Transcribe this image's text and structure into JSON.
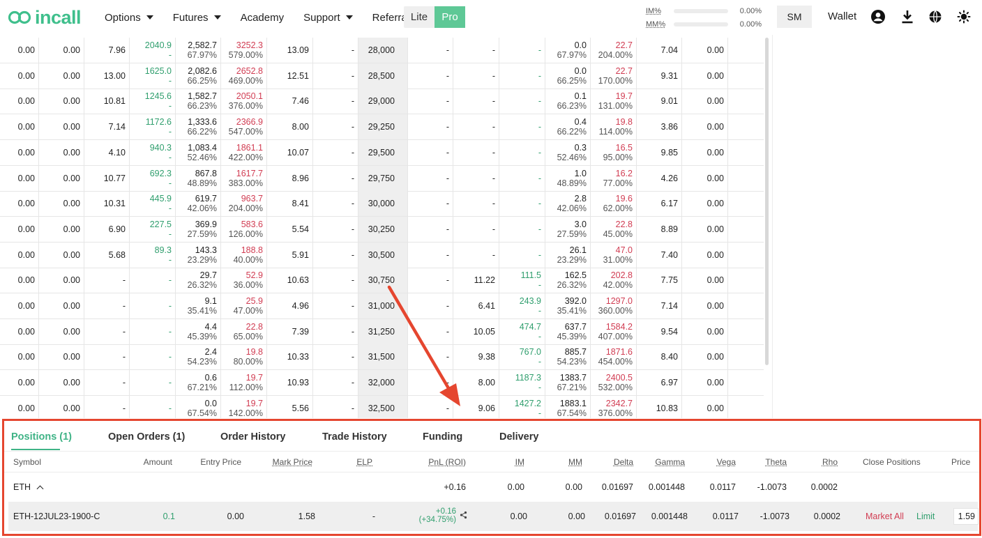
{
  "header": {
    "logo_text": "incall",
    "nav": [
      {
        "label": "Options",
        "has_dropdown": true
      },
      {
        "label": "Futures",
        "has_dropdown": true
      },
      {
        "label": "Academy",
        "has_dropdown": false
      },
      {
        "label": "Support",
        "has_dropdown": true
      },
      {
        "label": "Referral",
        "has_dropdown": false
      }
    ],
    "mode": {
      "lite": "Lite",
      "pro": "Pro",
      "active": "Pro"
    },
    "margin": {
      "im_label": "IM%",
      "im_value": "0.00%",
      "mm_label": "MM%",
      "mm_value": "0.00%"
    },
    "user_button": "SM",
    "wallet": "Wallet",
    "icons": [
      "account-icon",
      "download-icon",
      "globe-icon",
      "theme-sun-icon"
    ]
  },
  "chain": {
    "rows": [
      {
        "c": [
          "0.00",
          "0.00",
          "7.96"
        ],
        "bid": [
          "2040.9",
          "-"
        ],
        "mark": [
          "2,582.7",
          "67.97%"
        ],
        "ask": [
          "3252.3",
          "579.00%"
        ],
        "v": [
          "13.09",
          "-"
        ],
        "strike": "28,000",
        "p": [
          "-",
          "-"
        ],
        "pbid": [
          "-",
          ""
        ],
        "pmark": [
          "0.0",
          "67.97%"
        ],
        "pask": [
          "22.7",
          "204.00%"
        ],
        "e": [
          "7.04",
          "0.00"
        ]
      },
      {
        "c": [
          "0.00",
          "0.00",
          "13.00"
        ],
        "bid": [
          "1625.0",
          "-"
        ],
        "mark": [
          "2,082.6",
          "66.25%"
        ],
        "ask": [
          "2652.8",
          "469.00%"
        ],
        "v": [
          "12.51",
          "-"
        ],
        "strike": "28,500",
        "p": [
          "-",
          "-"
        ],
        "pbid": [
          "-",
          ""
        ],
        "pmark": [
          "0.0",
          "66.25%"
        ],
        "pask": [
          "22.7",
          "170.00%"
        ],
        "e": [
          "9.31",
          "0.00"
        ]
      },
      {
        "c": [
          "0.00",
          "0.00",
          "10.81"
        ],
        "bid": [
          "1245.6",
          "-"
        ],
        "mark": [
          "1,582.7",
          "66.23%"
        ],
        "ask": [
          "2050.1",
          "376.00%"
        ],
        "v": [
          "7.46",
          "-"
        ],
        "strike": "29,000",
        "p": [
          "-",
          "-"
        ],
        "pbid": [
          "-",
          ""
        ],
        "pmark": [
          "0.1",
          "66.23%"
        ],
        "pask": [
          "19.7",
          "131.00%"
        ],
        "e": [
          "9.01",
          "0.00"
        ]
      },
      {
        "c": [
          "0.00",
          "0.00",
          "7.14"
        ],
        "bid": [
          "1172.6",
          "-"
        ],
        "mark": [
          "1,333.6",
          "66.22%"
        ],
        "ask": [
          "2366.9",
          "547.00%"
        ],
        "v": [
          "8.00",
          "-"
        ],
        "strike": "29,250",
        "p": [
          "-",
          "-"
        ],
        "pbid": [
          "-",
          ""
        ],
        "pmark": [
          "0.4",
          "66.22%"
        ],
        "pask": [
          "19.8",
          "114.00%"
        ],
        "e": [
          "3.86",
          "0.00"
        ]
      },
      {
        "c": [
          "0.00",
          "0.00",
          "4.10"
        ],
        "bid": [
          "940.3",
          "-"
        ],
        "mark": [
          "1,083.4",
          "52.46%"
        ],
        "ask": [
          "1861.1",
          "422.00%"
        ],
        "v": [
          "10.07",
          "-"
        ],
        "strike": "29,500",
        "p": [
          "-",
          "-"
        ],
        "pbid": [
          "-",
          ""
        ],
        "pmark": [
          "0.3",
          "52.46%"
        ],
        "pask": [
          "16.5",
          "95.00%"
        ],
        "e": [
          "9.85",
          "0.00"
        ]
      },
      {
        "c": [
          "0.00",
          "0.00",
          "10.77"
        ],
        "bid": [
          "692.3",
          "-"
        ],
        "mark": [
          "867.8",
          "48.89%"
        ],
        "ask": [
          "1617.7",
          "383.00%"
        ],
        "v": [
          "8.96",
          "-"
        ],
        "strike": "29,750",
        "p": [
          "-",
          "-"
        ],
        "pbid": [
          "-",
          ""
        ],
        "pmark": [
          "1.0",
          "48.89%"
        ],
        "pask": [
          "16.2",
          "77.00%"
        ],
        "e": [
          "4.26",
          "0.00"
        ]
      },
      {
        "c": [
          "0.00",
          "0.00",
          "10.31"
        ],
        "bid": [
          "445.9",
          "-"
        ],
        "mark": [
          "619.7",
          "42.06%"
        ],
        "ask": [
          "963.7",
          "204.00%"
        ],
        "v": [
          "8.41",
          "-"
        ],
        "strike": "30,000",
        "p": [
          "-",
          "-"
        ],
        "pbid": [
          "-",
          ""
        ],
        "pmark": [
          "2.8",
          "42.06%"
        ],
        "pask": [
          "19.6",
          "62.00%"
        ],
        "e": [
          "6.17",
          "0.00"
        ]
      },
      {
        "c": [
          "0.00",
          "0.00",
          "6.90"
        ],
        "bid": [
          "227.5",
          "-"
        ],
        "mark": [
          "369.9",
          "27.59%"
        ],
        "ask": [
          "583.6",
          "126.00%"
        ],
        "v": [
          "5.54",
          "-"
        ],
        "strike": "30,250",
        "p": [
          "-",
          "-"
        ],
        "pbid": [
          "-",
          ""
        ],
        "pmark": [
          "3.0",
          "27.59%"
        ],
        "pask": [
          "22.8",
          "45.00%"
        ],
        "e": [
          "8.89",
          "0.00"
        ]
      },
      {
        "c": [
          "0.00",
          "0.00",
          "5.68"
        ],
        "bid": [
          "89.3",
          "-"
        ],
        "mark": [
          "143.3",
          "23.29%"
        ],
        "ask": [
          "188.8",
          "40.00%"
        ],
        "v": [
          "5.91",
          "-"
        ],
        "strike": "30,500",
        "p": [
          "-",
          "-"
        ],
        "pbid": [
          "-",
          ""
        ],
        "pmark": [
          "26.1",
          "23.29%"
        ],
        "pask": [
          "47.0",
          "31.00%"
        ],
        "e": [
          "7.40",
          "0.00"
        ]
      },
      {
        "c": [
          "0.00",
          "0.00",
          "-"
        ],
        "bid": [
          "-",
          ""
        ],
        "mark": [
          "29.7",
          "26.32%"
        ],
        "ask": [
          "52.9",
          "36.00%"
        ],
        "v": [
          "10.63",
          "-"
        ],
        "strike": "30,750",
        "p": [
          "-",
          "11.22"
        ],
        "pbid": [
          "111.5",
          "-"
        ],
        "pmark": [
          "162.5",
          "26.32%"
        ],
        "pask": [
          "202.8",
          "42.00%"
        ],
        "e": [
          "7.75",
          "0.00"
        ]
      },
      {
        "c": [
          "0.00",
          "0.00",
          "-"
        ],
        "bid": [
          "-",
          ""
        ],
        "mark": [
          "9.1",
          "35.41%"
        ],
        "ask": [
          "25.9",
          "47.00%"
        ],
        "v": [
          "4.96",
          "-"
        ],
        "strike": "31,000",
        "p": [
          "-",
          "6.41"
        ],
        "pbid": [
          "243.9",
          "-"
        ],
        "pmark": [
          "392.0",
          "35.41%"
        ],
        "pask": [
          "1297.0",
          "360.00%"
        ],
        "e": [
          "7.14",
          "0.00"
        ]
      },
      {
        "c": [
          "0.00",
          "0.00",
          "-"
        ],
        "bid": [
          "-",
          ""
        ],
        "mark": [
          "4.4",
          "45.39%"
        ],
        "ask": [
          "22.8",
          "65.00%"
        ],
        "v": [
          "7.39",
          "-"
        ],
        "strike": "31,250",
        "p": [
          "-",
          "10.05"
        ],
        "pbid": [
          "474.7",
          "-"
        ],
        "pmark": [
          "637.7",
          "45.39%"
        ],
        "pask": [
          "1584.2",
          "407.00%"
        ],
        "e": [
          "9.54",
          "0.00"
        ]
      },
      {
        "c": [
          "0.00",
          "0.00",
          "-"
        ],
        "bid": [
          "-",
          ""
        ],
        "mark": [
          "2.4",
          "54.23%"
        ],
        "ask": [
          "19.8",
          "80.00%"
        ],
        "v": [
          "10.33",
          "-"
        ],
        "strike": "31,500",
        "p": [
          "-",
          "9.38"
        ],
        "pbid": [
          "767.0",
          "-"
        ],
        "pmark": [
          "885.7",
          "54.23%"
        ],
        "pask": [
          "1871.6",
          "454.00%"
        ],
        "e": [
          "8.40",
          "0.00"
        ]
      },
      {
        "c": [
          "0.00",
          "0.00",
          "-"
        ],
        "bid": [
          "-",
          ""
        ],
        "mark": [
          "0.6",
          "67.21%"
        ],
        "ask": [
          "19.7",
          "112.00%"
        ],
        "v": [
          "10.93",
          "-"
        ],
        "strike": "32,000",
        "p": [
          "-",
          "8.00"
        ],
        "pbid": [
          "1187.3",
          "-"
        ],
        "pmark": [
          "1383.7",
          "67.21%"
        ],
        "pask": [
          "2400.5",
          "532.00%"
        ],
        "e": [
          "6.97",
          "0.00"
        ]
      },
      {
        "c": [
          "0.00",
          "0.00",
          "-"
        ],
        "bid": [
          "-",
          ""
        ],
        "mark": [
          "0.0",
          "67.54%"
        ],
        "ask": [
          "19.7",
          "142.00%"
        ],
        "v": [
          "5.56",
          "-"
        ],
        "strike": "32,500",
        "p": [
          "-",
          "9.06"
        ],
        "pbid": [
          "1427.2",
          "-"
        ],
        "pmark": [
          "1883.1",
          "67.54%"
        ],
        "pask": [
          "2342.7",
          "376.00%"
        ],
        "e": [
          "10.83",
          "0.00"
        ]
      }
    ]
  },
  "positions": {
    "tabs": [
      "Positions (1)",
      "Open Orders (1)",
      "Order History",
      "Trade History",
      "Funding",
      "Delivery"
    ],
    "active_tab": "Positions (1)",
    "columns": [
      "Symbol",
      "Amount",
      "Entry Price",
      "Mark Price",
      "ELP",
      "PnL (ROI)",
      "IM",
      "MM",
      "Delta",
      "Gamma",
      "Vega",
      "Theta",
      "Rho",
      "Close Positions",
      "Price"
    ],
    "group": {
      "symbol": "ETH",
      "pnl": "+0.16",
      "im": "0.00",
      "mm": "0.00",
      "delta": "0.01697",
      "gamma": "0.001448",
      "vega": "0.0117",
      "theta": "-1.0073",
      "rho": "0.0002"
    },
    "row": {
      "symbol": "ETH-12JUL23-1900-C",
      "amount": "0.1",
      "entry_price": "0.00",
      "mark_price": "1.58",
      "elp": "-",
      "pnl": "+0.16",
      "roi": "(+34.75%)",
      "im": "0.00",
      "mm": "0.00",
      "delta": "0.01697",
      "gamma": "0.001448",
      "vega": "0.0117",
      "theta": "-1.0073",
      "rho": "0.0002",
      "market_all": "Market All",
      "limit": "Limit",
      "price": "1.59"
    }
  },
  "colors": {
    "brand": "#3fbf8c",
    "bid": "#2f9e6d",
    "ask": "#d13c52",
    "highlight": "#e5462f"
  }
}
